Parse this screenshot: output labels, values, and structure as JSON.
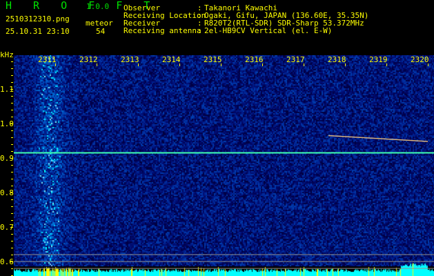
{
  "header": {
    "app_name": "H R O F F T",
    "version": "1.0.0",
    "filename": "2510312310.png",
    "datetime": "25.10.31 23:10",
    "meteor_label": "meteor",
    "meteor_count": "54",
    "info": [
      {
        "label": "Observer",
        "sep": ":",
        "value": "Takanori Kawachi"
      },
      {
        "label": "Receiving Location",
        "sep": ":",
        "value": "Ogaki, Gifu, JAPAN (136.60E, 35.35N)"
      },
      {
        "label": "Receiver",
        "sep": ":",
        "value": "R820T2(RTL-SDR) SDR-Sharp 53.372MHz"
      },
      {
        "label": "Receiving antenna",
        "sep": ":",
        "value": "2el-HB9CV Vertical (el. E-W)"
      }
    ]
  },
  "colors": {
    "text": "#ffff00",
    "title": "#00e000",
    "background": "#000000",
    "noise_low": "#000a60",
    "noise_high": "#1e50ff",
    "signal": "#00ffff",
    "level_bar": "#00ffff"
  },
  "chart_data": {
    "type": "heatmap",
    "ylabel": "kHz",
    "x_tick_labels": [
      "2311",
      "2312",
      "2313",
      "2314",
      "2315",
      "2316",
      "2317",
      "2318",
      "2319",
      "2320"
    ],
    "y_tick_labels": [
      "1.1",
      "1.0",
      "0.9",
      "0.8",
      "0.7",
      "0.6"
    ],
    "ylim": [
      0.55,
      1.2
    ],
    "carrier_khz": 0.915,
    "reference_lines_khz": [
      0.62,
      0.6,
      0.58
    ],
    "meteor_trace": {
      "from_minute": 2317.6,
      "to_minute": 2320.0,
      "from_khz": 0.965,
      "to_khz": 0.948
    }
  }
}
